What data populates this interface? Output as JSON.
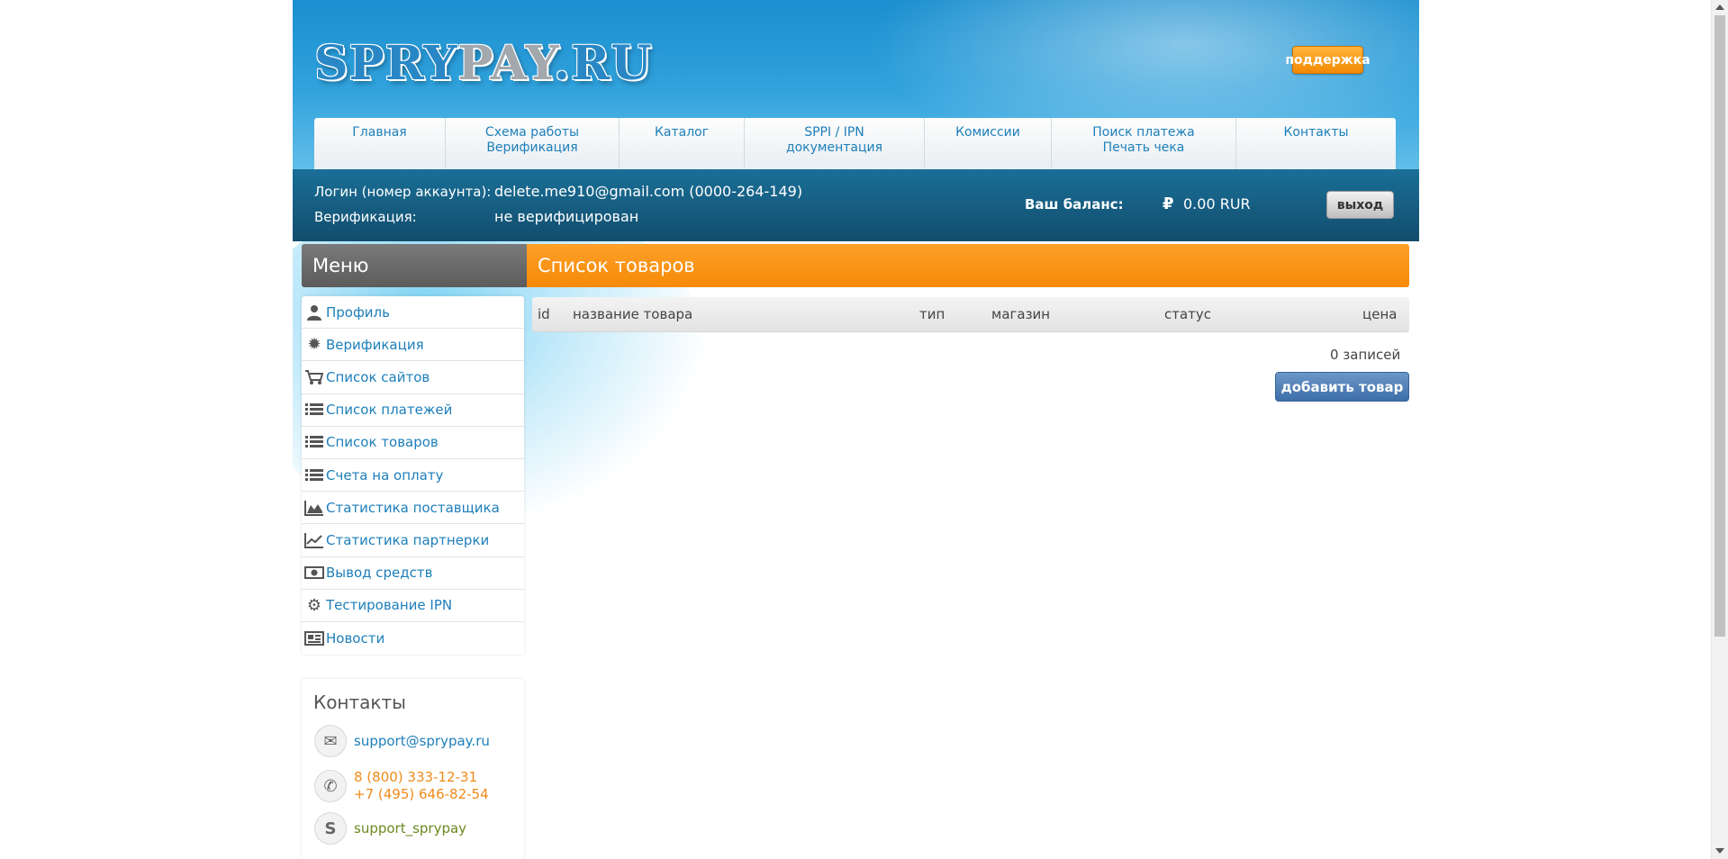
{
  "header": {
    "logo_left": "SPRY",
    "logo_mid": "PAY",
    "logo_right": ".RU",
    "support_label": "поддержка"
  },
  "nav": [
    {
      "line1": "Главная",
      "line2": ""
    },
    {
      "line1": "Схема работы",
      "line2": "Верификация"
    },
    {
      "line1": "Каталог",
      "line2": ""
    },
    {
      "line1": "SPPI / IPN",
      "line2": "документация"
    },
    {
      "line1": "Комиссии",
      "line2": ""
    },
    {
      "line1": "Поиск платежа",
      "line2": "Печать чека"
    },
    {
      "line1": "Контакты",
      "line2": ""
    }
  ],
  "account": {
    "login_label": "Логин (номер аккаунта):",
    "login_value": "delete.me910@gmail.com (0000-264-149)",
    "verification_label": "Верификация:",
    "verification_value": "не верифицирован",
    "balance_label": "Ваш баланс:",
    "balance_value": "0.00  RUR",
    "exit_label": "выход"
  },
  "menu": {
    "title": "Меню",
    "items": [
      {
        "label": "Профиль",
        "icon": "user-icon"
      },
      {
        "label": "Верификация",
        "icon": "badge-icon"
      },
      {
        "label": "Список сайтов",
        "icon": "cart-icon"
      },
      {
        "label": "Список платежей",
        "icon": "list-icon"
      },
      {
        "label": "Список товаров",
        "icon": "list-icon"
      },
      {
        "label": "Счета на оплату",
        "icon": "list-icon"
      },
      {
        "label": "Статистика поставщика",
        "icon": "area-chart-icon"
      },
      {
        "label": "Статистика партнерки",
        "icon": "line-chart-icon"
      },
      {
        "label": "Вывод средств",
        "icon": "money-icon"
      },
      {
        "label": "Тестирование IPN",
        "icon": "gears-icon"
      },
      {
        "label": "Новости",
        "icon": "newspaper-icon"
      }
    ]
  },
  "contacts": {
    "title": "Контакты",
    "email": "support@sprypay.ru",
    "phone1": "8 (800) 333-12-31",
    "phone2": "+7 (495) 646-82-54",
    "skype": "support_sprypay",
    "email_color": "#1d7fba",
    "phone_color": "#f08a1a",
    "skype_color": "#6a8a1e"
  },
  "main": {
    "title": "Список товаров",
    "columns": [
      "id",
      "название товара",
      "тип",
      "магазин",
      "статус",
      "цена"
    ],
    "records": "0 записей",
    "add_button": "добавить товар"
  }
}
